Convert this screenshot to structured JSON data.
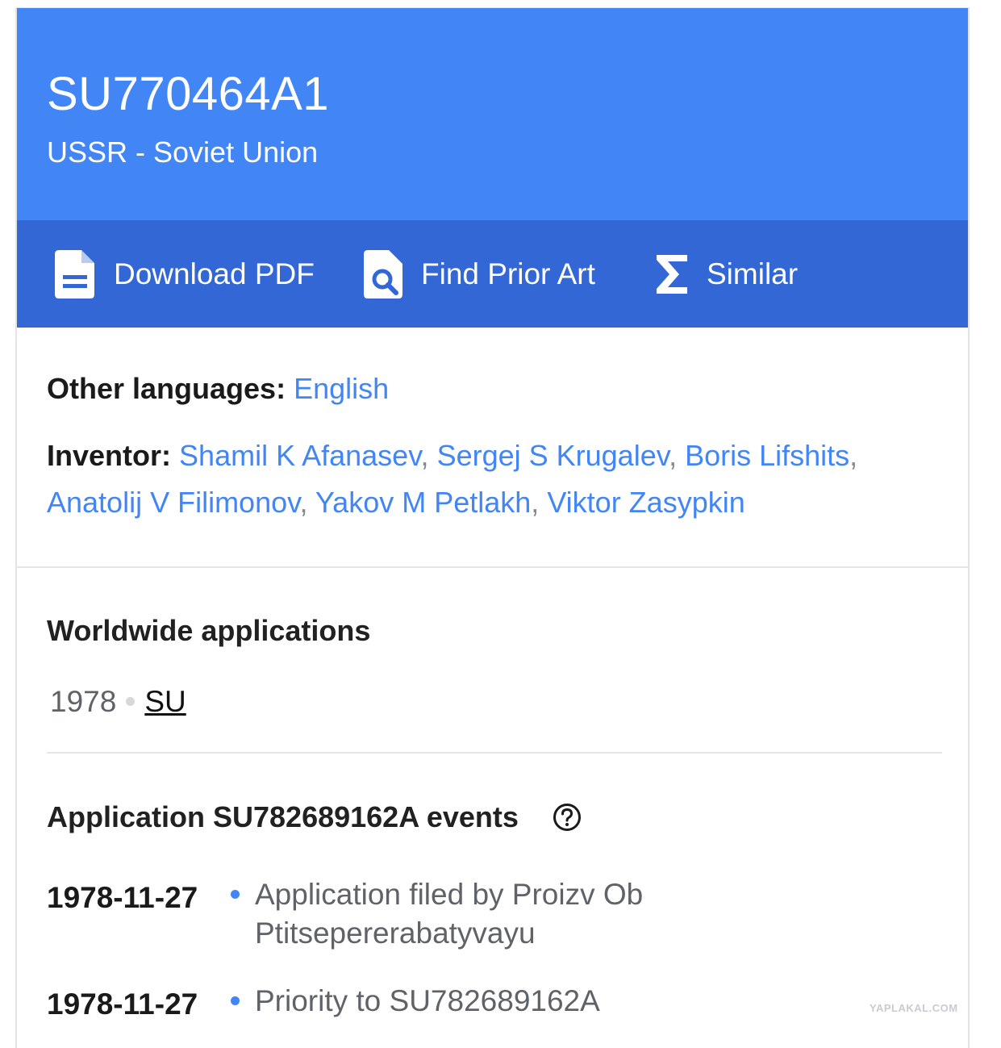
{
  "header": {
    "publication_number": "SU770464A1",
    "country": "USSR - Soviet Union"
  },
  "toolbar": {
    "download_pdf": {
      "label": "Download PDF",
      "icon": "pdf-document-icon"
    },
    "find_prior_art": {
      "label": "Find Prior Art",
      "icon": "document-search-icon"
    },
    "similar": {
      "label": "Similar",
      "icon": "sigma-icon"
    }
  },
  "other_languages": {
    "label": "Other languages:",
    "languages": [
      "English"
    ]
  },
  "inventor": {
    "label": "Inventor:",
    "names": [
      "Shamil K Afanasev",
      "Sergej S Krugalev",
      "Boris Lifshits",
      "Anatolij V Filimonov",
      "Yakov M Petlakh",
      "Viktor Zasypkin"
    ],
    "separator": ","
  },
  "worldwide": {
    "title": "Worldwide applications",
    "entries": [
      {
        "year": "1978",
        "country": "SU"
      }
    ]
  },
  "events": {
    "title": "Application SU782689162A events",
    "help_icon": "help-circle-icon",
    "items": [
      {
        "date": "1978-11-27",
        "text": "Application filed by Proizv Ob Ptitsepererabatyvayu"
      },
      {
        "date": "1978-11-27",
        "text": "Priority to SU782689162A"
      }
    ]
  },
  "watermark": "YAPLAKAL.COM",
  "colors": {
    "header_blue": "#4285f4",
    "toolbar_blue": "#3367d6",
    "link_blue": "#4285f4",
    "event_dot": "#4285f4"
  }
}
